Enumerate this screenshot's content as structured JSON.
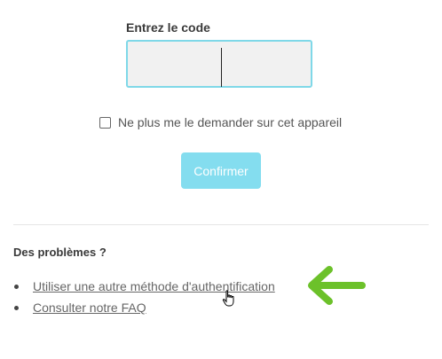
{
  "form": {
    "code_label": "Entrez le code",
    "code_value": "",
    "remember_label": "Ne plus me le demander sur cet appareil",
    "remember_checked": false,
    "confirm_label": "Confirmer"
  },
  "help": {
    "title": "Des problèmes ?",
    "links": [
      {
        "label": "Utiliser une autre méthode d'authentification"
      },
      {
        "label": "Consulter notre FAQ"
      }
    ]
  },
  "colors": {
    "input_border": "#7fd8e8",
    "button": "#84ddef",
    "annotation_arrow": "#6cc12a"
  },
  "icons": {
    "cursor": "hand-pointer-icon",
    "annotation": "green-arrow-icon"
  }
}
